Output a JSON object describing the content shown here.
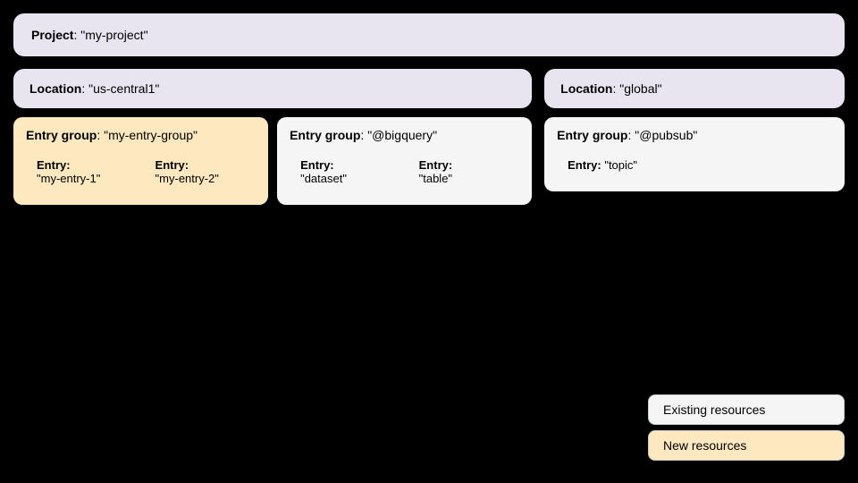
{
  "project": {
    "label": "Project",
    "value": "\"my-project\""
  },
  "locations": [
    {
      "id": "us-central1",
      "label": "Location",
      "value": "\"us-central1\"",
      "entryGroups": [
        {
          "id": "my-entry-group",
          "label": "Entry group",
          "value": "\"my-entry-group\"",
          "color": "orange",
          "entries": [
            {
              "label": "Entry",
              "value": "\"my-entry-1\"",
              "color": "orange"
            },
            {
              "label": "Entry",
              "value": "\"my-entry-2\"",
              "color": "orange"
            }
          ]
        },
        {
          "id": "bigquery",
          "label": "Entry group",
          "value": "\"@bigquery\"",
          "color": "white",
          "entries": [
            {
              "label": "Entry",
              "value": "\"dataset\"",
              "color": "white"
            },
            {
              "label": "Entry",
              "value": "\"table\"",
              "color": "white"
            }
          ]
        }
      ]
    },
    {
      "id": "global",
      "label": "Location",
      "value": "\"global\"",
      "entryGroups": [
        {
          "id": "pubsub",
          "label": "Entry group",
          "value": "\"@pubsub\"",
          "color": "white",
          "entries": [
            {
              "label": "Entry",
              "value": "\"topic\"",
              "color": "white"
            }
          ]
        }
      ]
    }
  ],
  "legend": {
    "existing_label": "Existing resources",
    "new_label": "New resources"
  }
}
